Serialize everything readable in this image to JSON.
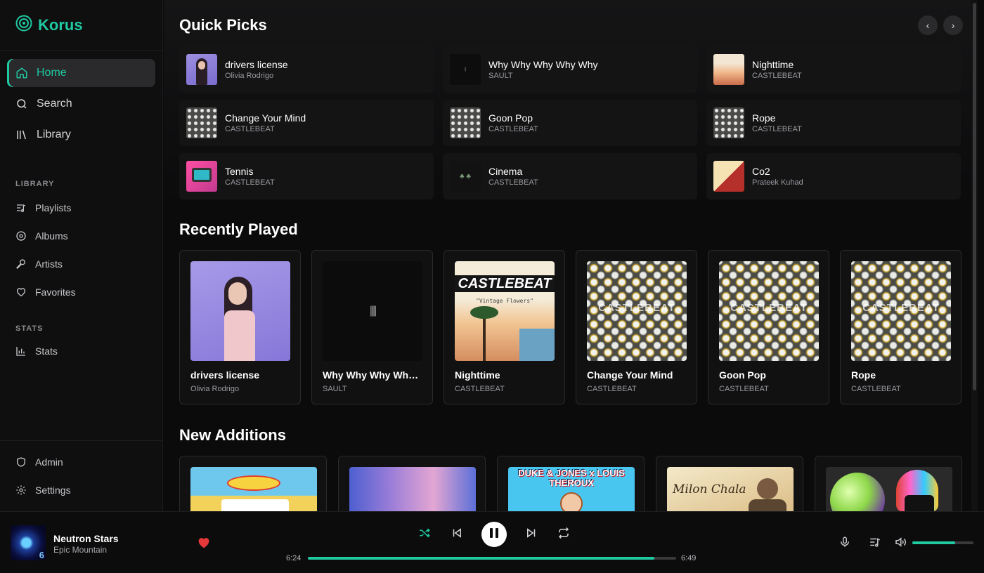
{
  "app": {
    "name": "Korus",
    "accent": "#1fc9a1"
  },
  "sidebar": {
    "nav": [
      {
        "label": "Home",
        "icon": "home-icon",
        "active": true
      },
      {
        "label": "Search",
        "icon": "search-icon"
      },
      {
        "label": "Library",
        "icon": "library-icon"
      }
    ],
    "library_label": "LIBRARY",
    "library_items": [
      {
        "label": "Playlists",
        "icon": "playlist-icon"
      },
      {
        "label": "Albums",
        "icon": "album-icon"
      },
      {
        "label": "Artists",
        "icon": "microphone-icon"
      },
      {
        "label": "Favorites",
        "icon": "heart-icon"
      }
    ],
    "stats_label": "STATS",
    "stats_items": [
      {
        "label": "Stats",
        "icon": "bar-chart-icon"
      }
    ],
    "bottom_items": [
      {
        "label": "Admin",
        "icon": "shield-icon"
      },
      {
        "label": "Settings",
        "icon": "gear-icon"
      }
    ]
  },
  "quick_picks": {
    "title": "Quick Picks",
    "items": [
      {
        "title": "drivers license",
        "artist": "Olivia Rodrigo"
      },
      {
        "title": "Why Why Why Why Why",
        "artist": "SAULT"
      },
      {
        "title": "Nighttime",
        "artist": "CASTLEBEAT"
      },
      {
        "title": "Change Your Mind",
        "artist": "CASTLEBEAT"
      },
      {
        "title": "Goon Pop",
        "artist": "CASTLEBEAT"
      },
      {
        "title": "Rope",
        "artist": "CASTLEBEAT"
      },
      {
        "title": "Tennis",
        "artist": "CASTLEBEAT"
      },
      {
        "title": "Cinema",
        "artist": "CASTLEBEAT"
      },
      {
        "title": "Co2",
        "artist": "Prateek Kuhad"
      }
    ]
  },
  "recently_played": {
    "title": "Recently Played",
    "items": [
      {
        "title": "drivers license",
        "artist": "Olivia Rodrigo"
      },
      {
        "title": "Why Why Why Why ...",
        "artist": "SAULT"
      },
      {
        "title": "Nighttime",
        "artist": "CASTLEBEAT",
        "art_text": "CASTLEBEAT",
        "art_subtext": "\"Vintage Flowers\""
      },
      {
        "title": "Change Your Mind",
        "artist": "CASTLEBEAT",
        "art_text": "CASTLEBEAT"
      },
      {
        "title": "Goon Pop",
        "artist": "CASTLEBEAT",
        "art_text": "CASTLEBEAT"
      },
      {
        "title": "Rope",
        "artist": "CASTLEBEAT",
        "art_text": "CASTLEBEAT"
      }
    ]
  },
  "new_additions": {
    "title": "New Additions",
    "art_texts": [
      "DUKE & JONES x LOUIS THEROUX",
      "Milon Chala"
    ]
  },
  "player": {
    "track_title": "Neutron Stars",
    "track_artist": "Epic Mountain",
    "current_time": "6:24",
    "total_time": "6:49",
    "progress": 0.94,
    "volume": 0.7,
    "liked": true
  }
}
